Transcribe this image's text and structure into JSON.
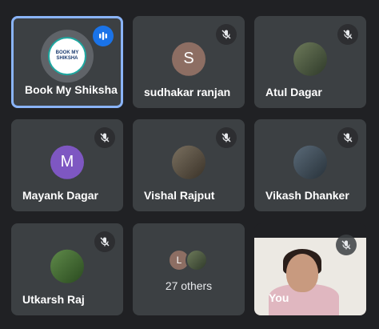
{
  "participants": [
    {
      "name": "Book My Shiksha",
      "avatar_type": "logo",
      "logo_text": "BOOK MY SHIKSHA",
      "speaking": true,
      "muted": false
    },
    {
      "name": "sudhakar ranjan",
      "avatar_type": "initial",
      "initial": "S",
      "avatar_color": "#8d6e63",
      "muted": true
    },
    {
      "name": "Atul Dagar",
      "avatar_type": "photo",
      "muted": true
    },
    {
      "name": "Mayank Dagar",
      "avatar_type": "initial",
      "initial": "M",
      "avatar_color": "#7e57c2",
      "muted": true
    },
    {
      "name": "Vishal Rajput",
      "avatar_type": "photo",
      "muted": true
    },
    {
      "name": "Vikash Dhanker",
      "avatar_type": "photo",
      "muted": true
    },
    {
      "name": "Utkarsh Raj",
      "avatar_type": "photo",
      "muted": true
    }
  ],
  "others": {
    "label": "27 others",
    "initial": "L",
    "initial_color": "#8d6e63"
  },
  "self": {
    "name": "You",
    "muted": true
  },
  "colors": {
    "background": "#202124",
    "tile": "#3c4043",
    "active_border": "#8ab4f8",
    "speaking": "#1a73e8"
  }
}
